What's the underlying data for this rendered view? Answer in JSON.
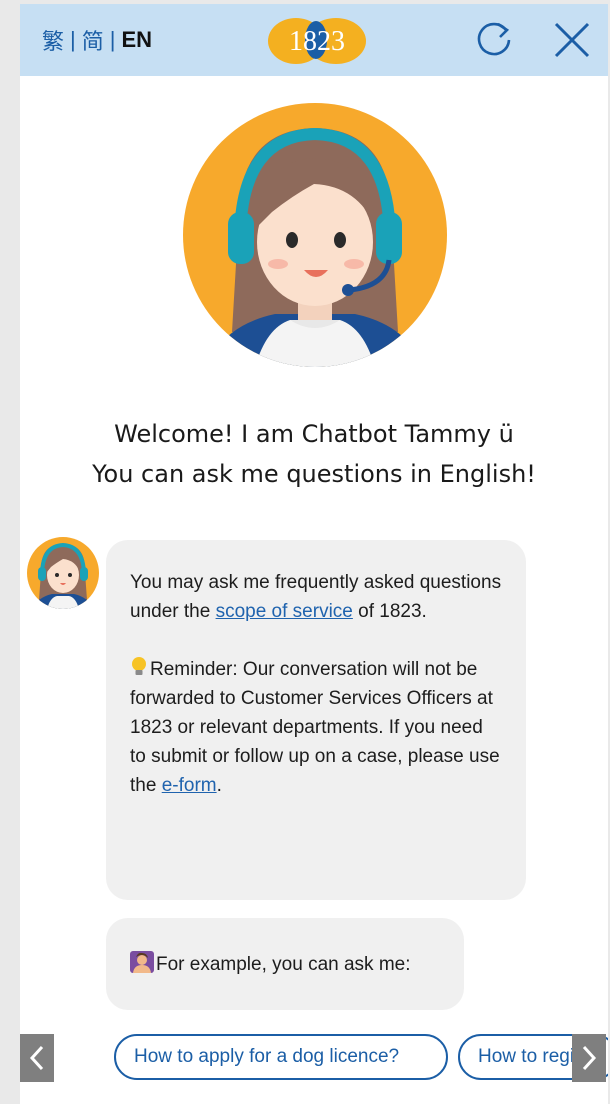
{
  "header": {
    "lang_traditional": "繁",
    "lang_simplified": "简",
    "lang_english": "EN",
    "separator": "|",
    "logo_text": "1823",
    "colors": {
      "bar": "#c6dff3",
      "accent": "#1b5ea6",
      "logo": "#f4b020"
    },
    "icons": [
      "refresh-icon",
      "close-icon"
    ]
  },
  "welcome": {
    "line1": "Welcome! I am Chatbot Tammy",
    "smiley": "ü",
    "line2": "You can ask me questions in English!"
  },
  "messages": {
    "intro_text_1": "You may ask me frequently asked questions under the ",
    "intro_link": "scope of service",
    "intro_text_2": " of 1823.",
    "reminder_text": "Reminder: Our conversation will not be forwarded to Customer Services Officers at 1823 or relevant departments. If you need to submit or follow up on a case, please use the ",
    "reminder_link": "e-form",
    "reminder_end": ".",
    "example_text": "For example, you can ask me:"
  },
  "suggestions": [
    "How to apply for a dog licence?",
    "How to regis"
  ],
  "nav": {
    "prev": "‹",
    "next": "›"
  }
}
